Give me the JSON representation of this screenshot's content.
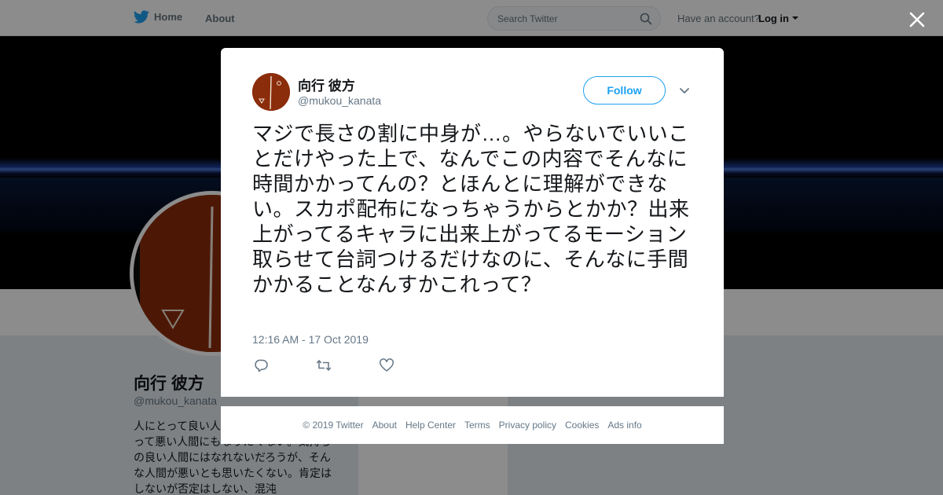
{
  "topbar": {
    "home_label": "Home",
    "about_label": "About",
    "search_placeholder": "Search Twitter",
    "account_prompt": "Have an account?",
    "login_label": "Log in"
  },
  "profile": {
    "name": "向行 彼方",
    "handle": "@mukou_kanata",
    "bio": "人にとって良い人間になれないからといって悪い人間にもなりたくない。気持ちの良い人間にはなれないだろうが、そんな人間が悪いとも思いたくない。肯定はしないが否定はしない、混沌"
  },
  "tweet": {
    "author_name": "向行 彼方",
    "author_handle": "@mukou_kanata",
    "follow_label": "Follow",
    "text": "マジで長さの割に中身が…。やらないでいいことだけやった上で、なんでこの内容でそんなに時間かかってんの？とほんとに理解ができない。スカポ配布になっちゃうからとかか？出来上がってるキャラに出来上がってるモーション取らせて台詞つけるだけなのに、そんなに手間かかることなんすかこれって？",
    "timestamp": "12:16 AM - 17 Oct 2019"
  },
  "footer": {
    "links": [
      "© 2019 Twitter",
      "About",
      "Help Center",
      "Terms",
      "Privacy policy",
      "Cookies",
      "Ads info"
    ]
  },
  "colors": {
    "brand": "#1da1f2",
    "avatar": "#8b2c0a",
    "text": "#14171a",
    "muted": "#657786"
  }
}
